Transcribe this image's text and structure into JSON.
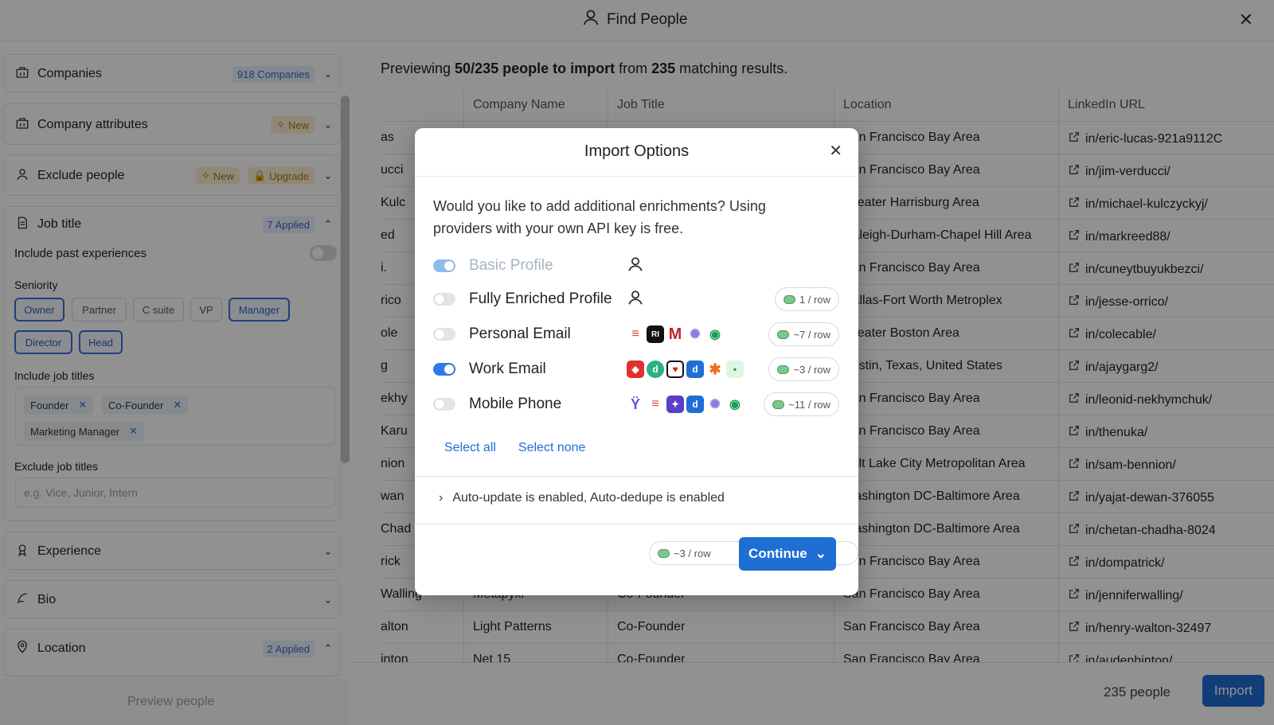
{
  "topbar": {
    "title": "Find People",
    "close": "✕"
  },
  "sidebar": {
    "companies": {
      "label": "Companies",
      "badge": "918 Companies"
    },
    "company_attributes": {
      "label": "Company attributes",
      "badge": "New"
    },
    "exclude_people": {
      "label": "Exclude people",
      "badge_new": "New",
      "badge_upgrade": "Upgrade"
    },
    "job_title": {
      "label": "Job title",
      "badge": "7 Applied",
      "include_past": "Include past experiences",
      "seniority_label": "Seniority",
      "seniority": [
        {
          "label": "Owner",
          "selected": true
        },
        {
          "label": "Partner",
          "selected": false
        },
        {
          "label": "C suite",
          "selected": false
        },
        {
          "label": "VP",
          "selected": false
        },
        {
          "label": "Manager",
          "selected": true
        },
        {
          "label": "Director",
          "selected": true
        },
        {
          "label": "Head",
          "selected": true
        }
      ],
      "include_titles_label": "Include job titles",
      "include_titles": [
        "Founder",
        "Co-Founder",
        "Marketing Manager"
      ],
      "exclude_titles_label": "Exclude job titles",
      "exclude_placeholder": "e.g. Vice, Junior, Intern"
    },
    "experience": {
      "label": "Experience"
    },
    "bio": {
      "label": "Bio"
    },
    "location": {
      "label": "Location",
      "badge": "2 Applied"
    },
    "preview_button": "Preview people"
  },
  "main": {
    "previewing": {
      "prefix": "Previewing ",
      "bold1": "50/235 people to import",
      "middle": " from ",
      "bold2": "235",
      "suffix": " matching results."
    },
    "columns": {
      "name": "",
      "company": "Company Name",
      "job": "Job Title",
      "location": "Location",
      "linkedin": "LinkedIn URL"
    },
    "rows": [
      {
        "name": "as",
        "company": "",
        "job": "",
        "location": "San Francisco Bay Area",
        "linkedin": "in/eric-lucas-921a9112C"
      },
      {
        "name": "ucci",
        "company": "",
        "job": "",
        "location": "San Francisco Bay Area",
        "linkedin": "in/jim-verducci/"
      },
      {
        "name": "Kulc",
        "company": "",
        "job": "",
        "location": "Greater Harrisburg Area",
        "linkedin": "in/michael-kulczyckyj/"
      },
      {
        "name": "ed",
        "company": "",
        "job": "",
        "location": "Raleigh-Durham-Chapel Hill Area",
        "linkedin": "in/markreed88/"
      },
      {
        "name": "i.",
        "company": "",
        "job": "",
        "location": "San Francisco Bay Area",
        "linkedin": "in/cuneytbuyukbezci/"
      },
      {
        "name": "rico",
        "company": "",
        "job": "",
        "location": "Dallas-Fort Worth Metroplex",
        "linkedin": "in/jesse-orrico/"
      },
      {
        "name": "ole",
        "company": "",
        "job": "",
        "location": "Greater Boston Area",
        "linkedin": "in/colecable/"
      },
      {
        "name": "g",
        "company": "",
        "job": "",
        "location": "Austin, Texas, United States",
        "linkedin": "in/ajaygarg2/"
      },
      {
        "name": "ekhy",
        "company": "",
        "job": "",
        "location": "San Francisco Bay Area",
        "linkedin": "in/leonid-nekhymchuk/"
      },
      {
        "name": "Karu",
        "company": "",
        "job": "",
        "location": "San Francisco Bay Area",
        "linkedin": "in/thenuka/"
      },
      {
        "name": "nion",
        "company": "",
        "job": "",
        "location": "Salt Lake City Metropolitan Area",
        "linkedin": "in/sam-bennion/"
      },
      {
        "name": "wan",
        "company": "",
        "job": "",
        "location": "Washington DC-Baltimore Area",
        "linkedin": "in/yajat-dewan-376055"
      },
      {
        "name": "Chad",
        "company": "",
        "job": "",
        "location": "Washington DC-Baltimore Area",
        "linkedin": "in/chetan-chadha-8024"
      },
      {
        "name": "rick",
        "company": "",
        "job": "",
        "location": "San Francisco Bay Area",
        "linkedin": "in/dompatrick/"
      },
      {
        "name": "Walling",
        "company": "Metapyxl",
        "job": "Co-Founder",
        "location": "San Francisco Bay Area",
        "linkedin": "in/jenniferwalling/"
      },
      {
        "name": "alton",
        "company": "Light Patterns",
        "job": "Co-Founder",
        "location": "San Francisco Bay Area",
        "linkedin": "in/henry-walton-32497"
      },
      {
        "name": "inton",
        "company": "Net 15",
        "job": "Co-Founder",
        "location": "San Francisco Bay Area",
        "linkedin": "in/audenhinton/"
      }
    ],
    "footer": {
      "count": "235 people",
      "import": "Import"
    }
  },
  "modal": {
    "title": "Import Options",
    "close": "✕",
    "intro": "Would you like to add additional enrichments? Using providers with your own API key is free.",
    "options": [
      {
        "label": "Basic Profile",
        "on": true,
        "disabled": true,
        "cost": ""
      },
      {
        "label": "Fully Enriched Profile",
        "on": false,
        "disabled": false,
        "cost": "1 / row"
      },
      {
        "label": "Personal Email",
        "on": false,
        "disabled": false,
        "cost": "~7 / row"
      },
      {
        "label": "Work Email",
        "on": true,
        "disabled": false,
        "cost": "~3 / row"
      },
      {
        "label": "Mobile Phone",
        "on": false,
        "disabled": false,
        "cost": "~11 / row"
      }
    ],
    "select_all": "Select all",
    "select_none": "Select none",
    "auto_line": "Auto-update is enabled, Auto-dedupe is enabled",
    "footer_cost": "~3 / row",
    "continue": "Continue",
    "colors": {
      "accent": "#1f6ed4"
    }
  }
}
